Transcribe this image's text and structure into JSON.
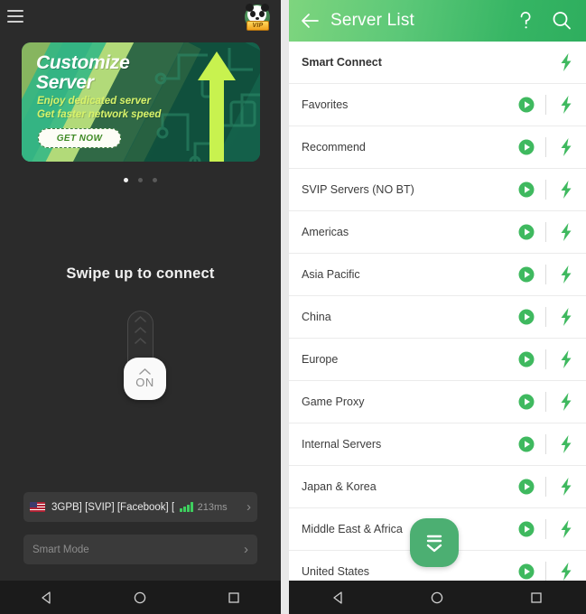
{
  "left_phone": {
    "menu_icon": "hamburger-menu-icon",
    "vip_badge": {
      "label": "VIP",
      "icon": "panda-avatar-icon"
    },
    "banner": {
      "title_line1": "Customize",
      "title_line2": "Server",
      "sub_line1": "Enjoy dedicated server",
      "sub_line2": "Get faster network speed",
      "cta_label": "GET NOW",
      "arrow_icon": "up-arrow-icon",
      "accent_color": "#c8f24f",
      "bg_color": "#1e7a5d"
    },
    "carousel": {
      "total_dots": 3,
      "active_index": 0
    },
    "swipe_prompt": "Swipe up to connect",
    "connect_slider": {
      "knob_label": "ON",
      "chevron_icon": "chevron-up-icon",
      "chevron_count": 3
    },
    "server_bar": {
      "flag_icon": "us-flag-icon",
      "server_name": "3GPB] [SVIP] [Facebook] [",
      "signal_icon": "signal-bars-icon",
      "ping": "213ms",
      "chevron": "›"
    },
    "mode_bar": {
      "label": "Smart Mode",
      "chevron": "›"
    },
    "nav": {
      "back": "back-triangle-icon",
      "home": "home-circle-icon",
      "recents": "recents-square-icon"
    }
  },
  "right_phone": {
    "header": {
      "back_icon": "arrow-left-icon",
      "title": "Server List",
      "help_icon": "question-mark-icon",
      "search_icon": "search-icon",
      "gradient_from": "#7ed57e",
      "gradient_to": "#2eae5e"
    },
    "accent_color": "#3fb95f",
    "rows": [
      {
        "label": "Smart Connect",
        "bold": true,
        "has_play": false,
        "has_bolt": true
      },
      {
        "label": "Favorites",
        "bold": false,
        "has_play": true,
        "has_bolt": true
      },
      {
        "label": "Recommend",
        "bold": false,
        "has_play": true,
        "has_bolt": true
      },
      {
        "label": "SVIP Servers (NO BT)",
        "bold": false,
        "has_play": true,
        "has_bolt": true
      },
      {
        "label": "Americas",
        "bold": false,
        "has_play": true,
        "has_bolt": true
      },
      {
        "label": "Asia Pacific",
        "bold": false,
        "has_play": true,
        "has_bolt": true
      },
      {
        "label": "China",
        "bold": false,
        "has_play": true,
        "has_bolt": true
      },
      {
        "label": "Europe",
        "bold": false,
        "has_play": true,
        "has_bolt": true
      },
      {
        "label": "Game Proxy",
        "bold": false,
        "has_play": true,
        "has_bolt": true
      },
      {
        "label": "Internal Servers",
        "bold": false,
        "has_play": true,
        "has_bolt": true
      },
      {
        "label": "Japan & Korea",
        "bold": false,
        "has_play": true,
        "has_bolt": true
      },
      {
        "label": "Middle East & Africa",
        "bold": false,
        "has_play": true,
        "has_bolt": true
      },
      {
        "label": "United States",
        "bold": false,
        "has_play": true,
        "has_bolt": true
      }
    ],
    "fab": {
      "icon": "collapse-all-down-icon",
      "color": "#4caf72"
    },
    "nav": {
      "back": "back-triangle-icon",
      "home": "home-circle-icon",
      "recents": "recents-square-icon"
    }
  }
}
